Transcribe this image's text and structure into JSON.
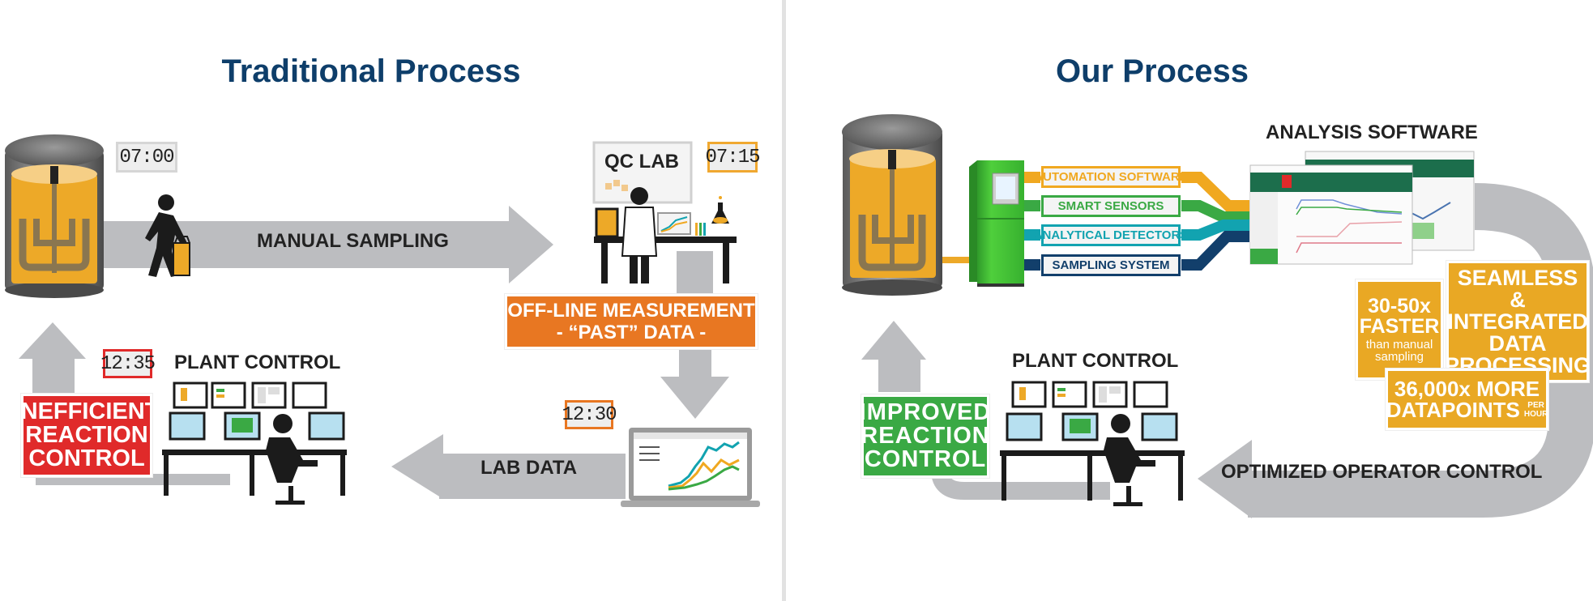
{
  "left_panel": {
    "title": "Traditional Process",
    "clocks": {
      "sample_time": "07:00",
      "lab_time": "07:15",
      "lab_data_time": "12:30",
      "control_time": "12:35"
    },
    "manual_sampling_label": "MANUAL SAMPLING",
    "qc_lab_label": "QC LAB",
    "offline_measurement": {
      "line1": "OFF-LINE MEASUREMENT",
      "line2": "- “PAST” DATA -"
    },
    "lab_data_label": "LAB DATA",
    "plant_control_label": "PLANT CONTROL",
    "outcome": {
      "line1": "INEFFICIENT",
      "line2": "REACTION",
      "line3": "CONTROL"
    }
  },
  "right_panel": {
    "title": "Our Process",
    "analysis_software_label": "ANALYSIS SOFTWARE",
    "components": [
      {
        "label": "AUTOMATION SOFTWARE",
        "color": "#f0a820"
      },
      {
        "label": "SMART SENSORS",
        "color": "#3aa944"
      },
      {
        "label": "ANALYTICAL DETECTORS",
        "color": "#12a3b0"
      },
      {
        "label": "SAMPLING SYSTEM",
        "color": "#123f6b"
      }
    ],
    "benefits": {
      "faster": {
        "line1": "30-50x",
        "line2": "FASTER",
        "line3": "than manual",
        "line4": "sampling"
      },
      "seamless": {
        "line1": "SEAMLESS &",
        "line2": "INTEGRATED",
        "line3": "DATA",
        "line4": "PROCESSING"
      },
      "datapoints": {
        "line1": "36,000x MORE",
        "line2": "DATAPOINTS",
        "unit_top": "PER",
        "unit_bottom": "HOUR"
      }
    },
    "operator_control_label": "OPTIMIZED OPERATOR CONTROL",
    "plant_control_label": "PLANT CONTROL",
    "outcome": {
      "line1": "IMPROVED",
      "line2": "REACTION",
      "line3": "CONTROL"
    }
  },
  "colors": {
    "title_blue": "#0e3e6a",
    "reactor_amber": "#eda928",
    "arrow_gray": "#bcbdc0",
    "offline_orange": "#e87722",
    "inefficient_red": "#e02a2a",
    "improved_green": "#3aa944",
    "benefit_amber": "#e9a824"
  }
}
